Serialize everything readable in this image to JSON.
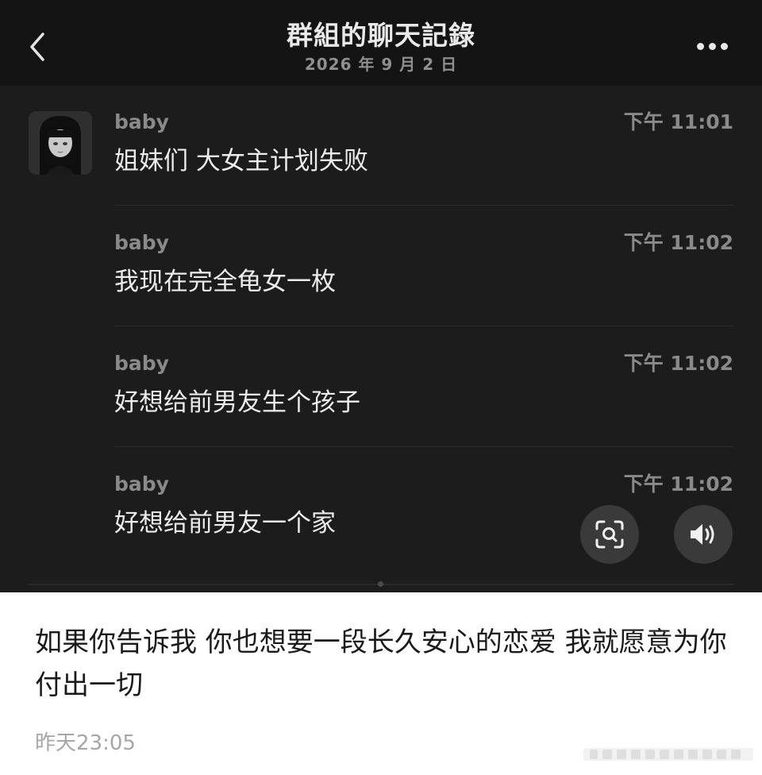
{
  "chat_header": {
    "back_icon": "chevron-left-icon",
    "title": "群組的聊天記錄",
    "date": "2026 年 9 月 2 日",
    "more_icon": "more-horizontal-icon"
  },
  "messages": [
    {
      "sender": "baby",
      "time": "下午 11:01",
      "text": "姐妹们 大女主计划失败"
    },
    {
      "sender": "baby",
      "time": "下午 11:02",
      "text": "我现在完全龟女一枚"
    },
    {
      "sender": "baby",
      "time": "下午 11:02",
      "text": "好想给前男友生个孩子"
    },
    {
      "sender": "baby",
      "time": "下午 11:02",
      "text": "好想给前男友一个家"
    }
  ],
  "floating_buttons": {
    "scan_icon": "scan-icon",
    "speaker_icon": "speaker-icon"
  },
  "post": {
    "caption": "如果你告诉我 你也想要一段长久安心的恋爱 我就愿意为你付出一切",
    "timestamp": "昨天23:05"
  },
  "colors": {
    "chat_background": "#1c1c1c",
    "header_background": "#141414",
    "message_text": "#ececec",
    "meta_text": "#8a8a8a",
    "button_background": "#3a3a3a",
    "page_background": "#ffffff"
  }
}
